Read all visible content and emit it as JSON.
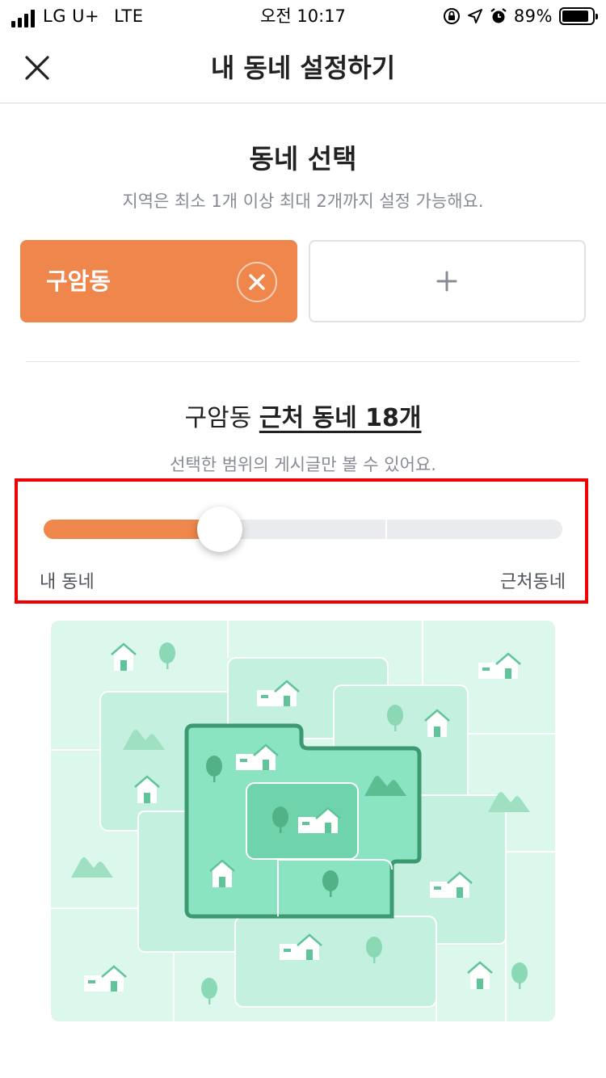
{
  "status": {
    "carrier": "LG U+",
    "network": "LTE",
    "time": "오전 10:17",
    "battery": "89%",
    "battery_level": 0.89
  },
  "header": {
    "title": "내 동네 설정하기",
    "close_icon": "close-icon"
  },
  "neighborhood": {
    "title": "동네 선택",
    "subtitle": "지역은 최소 1개 이상 최대 2개까지 설정 가능해요.",
    "selected_label": "구암동",
    "remove_icon": "x-circle-icon",
    "add_icon": "plus-icon"
  },
  "range": {
    "area_name": "구암동",
    "nearby_text": "근처 동네 18개",
    "subtitle": "선택한 범위의 게시글만 볼 수 있어요.",
    "level": 1,
    "max_level": 3,
    "min_label": "내 동네",
    "max_label": "근처동네"
  },
  "colors": {
    "accent": "#ef874c",
    "highlight_border": "#f00000",
    "map_light": "#d9f7ea",
    "map_mid": "#c4f0e0",
    "map_strong": "#8ae4c2",
    "map_border": "#3d9a70"
  }
}
